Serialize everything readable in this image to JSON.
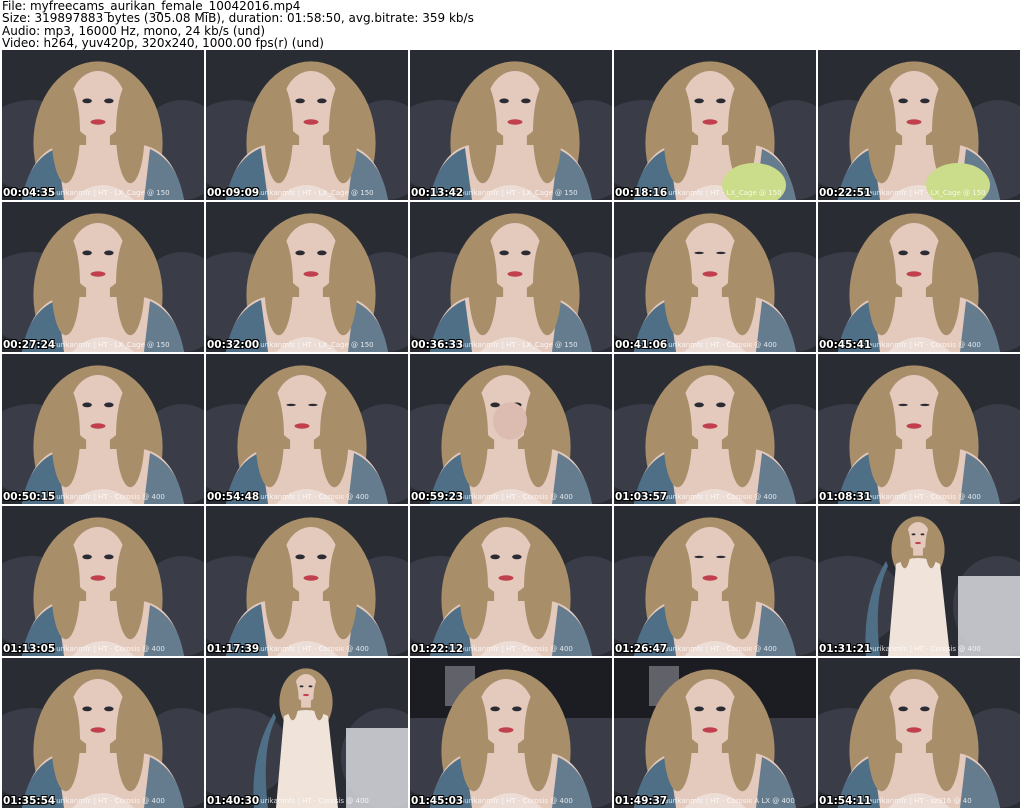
{
  "header": {
    "file_line": "File: myfreecams_aurikan_female_10042016.mp4",
    "size_line": "Size: 319897883 bytes (305.08 MiB), duration: 01:58:50, avg.bitrate: 359 kb/s",
    "audio_line": "Audio: mp3, 16000 Hz, mono, 24 kb/s (und)",
    "video_line": "Video: h264, yuv420p, 320x240, 1000.00 fps(r) (und)"
  },
  "thumbnails": [
    {
      "time": "00:04:35",
      "watermark": "aurikanmfc | HT - LX_Cage @ 150",
      "scene": "closeup-smile"
    },
    {
      "time": "00:09:09",
      "watermark": "aurikanmfc | HT - LX_Cage @ 150",
      "scene": "closeup-look-right"
    },
    {
      "time": "00:13:42",
      "watermark": "aurikanmfc | HT - LX_Cage @ 150",
      "scene": "closeup-look-right"
    },
    {
      "time": "00:18:16",
      "watermark": "aurikanmfc | HT - LX_Cage @ 150",
      "scene": "closeup-plush"
    },
    {
      "time": "00:22:51",
      "watermark": "aurikanmfc | HT - LX_Cage @ 150",
      "scene": "closeup-smile-plush"
    },
    {
      "time": "00:27:24",
      "watermark": "aurikanmfc | HT - LX_Cage @ 150",
      "scene": "closeup-smile"
    },
    {
      "time": "00:32:00",
      "watermark": "aurikanmfc | HT - LX_Cage @ 150",
      "scene": "closeup-look-right"
    },
    {
      "time": "00:36:33",
      "watermark": "aurikanmfc | HT - LX_Cage @ 150",
      "scene": "closeup-profile"
    },
    {
      "time": "00:41:06",
      "watermark": "aurikanmfc | HT - Corosis @ 400",
      "scene": "closeup-look-down"
    },
    {
      "time": "00:45:41",
      "watermark": "aurikanmfc | HT - Corosis @ 400",
      "scene": "closeup-smile"
    },
    {
      "time": "00:50:15",
      "watermark": "aurikanmfc | HT - Corosis @ 400",
      "scene": "closeup-smile"
    },
    {
      "time": "00:54:48",
      "watermark": "aurikanmfc | HT - Corosis @ 400",
      "scene": "closeup-look-down"
    },
    {
      "time": "00:59:23",
      "watermark": "aurikanmfc | HT - Corosis @ 400",
      "scene": "closeup-hand"
    },
    {
      "time": "01:03:57",
      "watermark": "aurikanmfc | HT - Corosis @ 400",
      "scene": "closeup-smile"
    },
    {
      "time": "01:08:31",
      "watermark": "aurikanmfc | HT - Corosis @ 400",
      "scene": "closeup-look-down"
    },
    {
      "time": "01:13:05",
      "watermark": "aurikanmfc | HT - Corosis @ 400",
      "scene": "closeup-smile"
    },
    {
      "time": "01:17:39",
      "watermark": "aurikanmfc | HT - Corosis @ 400",
      "scene": "closeup-look-right"
    },
    {
      "time": "01:22:12",
      "watermark": "aurikanmfc | HT - Corosis @ 400",
      "scene": "closeup-smile"
    },
    {
      "time": "01:26:47",
      "watermark": "aurikanmfc | HT - Corosis @ 400",
      "scene": "closeup-look-down"
    },
    {
      "time": "01:31:21",
      "watermark": "aurikanmfc | HT - Corosis @ 400",
      "scene": "wide-seated"
    },
    {
      "time": "01:35:54",
      "watermark": "aurikanmfc | HT - Corosis @ 400",
      "scene": "closeup-smile"
    },
    {
      "time": "01:40:30",
      "watermark": "aurikanmfc | HT - Corosis @ 400",
      "scene": "wide-seated"
    },
    {
      "time": "01:45:03",
      "watermark": "aurikanmfc | HT - Corosis @ 400",
      "scene": "closeup-room"
    },
    {
      "time": "01:49:37",
      "watermark": "aurikanmfc | HT - Corosis A LX @ 400",
      "scene": "closeup-room"
    },
    {
      "time": "01:54:11",
      "watermark": "aurikanmfc | HT - sz916 @ 40",
      "scene": "closeup-smile"
    }
  ],
  "colors": {
    "background": "#ffffff",
    "header_text": "#000000",
    "timestamp_text": "#ffffff",
    "scene_dark": "#2a2c33",
    "pillow": "#3a3d47",
    "skin": "#e4c9bd",
    "hair": "#a98e6a",
    "lips": "#c0404e",
    "tattoo": "#4f6f86",
    "plush": "#cbdc8a"
  }
}
